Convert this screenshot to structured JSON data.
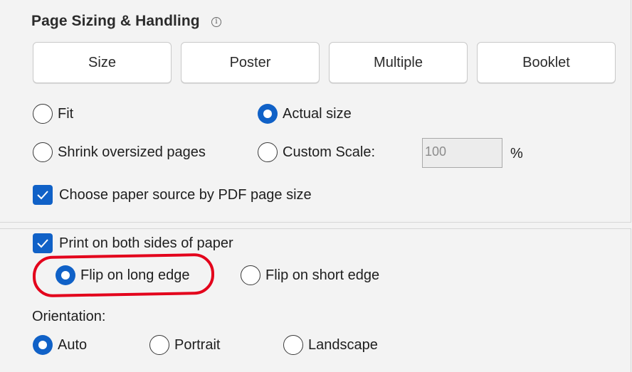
{
  "page_sizing": {
    "title": "Page Sizing & Handling",
    "info_icon": "info-icon",
    "buttons": [
      {
        "label": "Size"
      },
      {
        "label": "Poster"
      },
      {
        "label": "Multiple"
      },
      {
        "label": "Booklet"
      }
    ],
    "options": {
      "fit": {
        "label": "Fit",
        "selected": false
      },
      "actual_size": {
        "label": "Actual size",
        "selected": true
      },
      "shrink": {
        "label": "Shrink oversized pages",
        "selected": false
      },
      "custom_scale": {
        "label": "Custom Scale:",
        "selected": false,
        "value": "100",
        "unit": "%"
      }
    },
    "paper_source": {
      "label": "Choose paper source by PDF page size",
      "checked": true
    }
  },
  "duplex": {
    "both_sides": {
      "label": "Print on both sides of paper",
      "checked": true
    },
    "flip_long": {
      "label": "Flip on long edge",
      "selected": true
    },
    "flip_short": {
      "label": "Flip on short edge",
      "selected": false
    },
    "annotation_color": "#e3001b"
  },
  "orientation": {
    "label": "Orientation:",
    "options": [
      {
        "label": "Auto",
        "selected": true
      },
      {
        "label": "Portrait",
        "selected": false
      },
      {
        "label": "Landscape",
        "selected": false
      }
    ]
  },
  "colors": {
    "accent": "#1061c7",
    "background": "#f3f3f3"
  }
}
